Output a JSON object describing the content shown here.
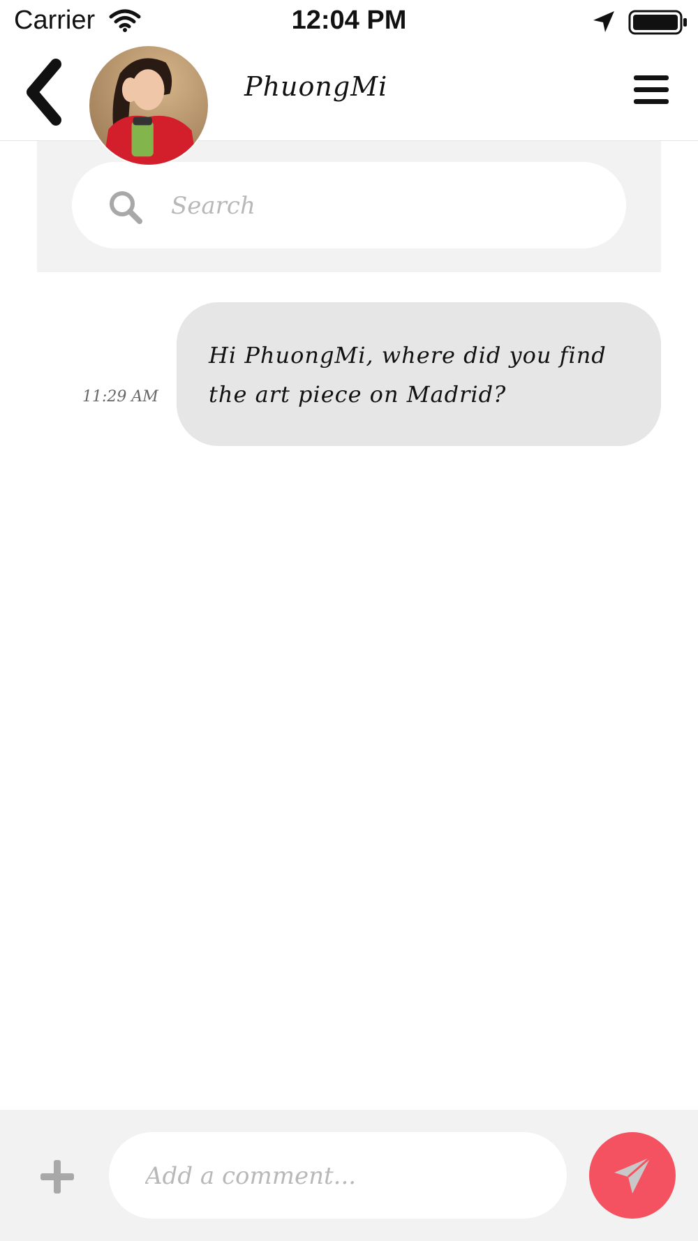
{
  "status_bar": {
    "carrier": "Carrier",
    "time": "12:04 PM",
    "icons": [
      "wifi-icon",
      "location-icon",
      "battery-icon"
    ]
  },
  "header": {
    "contact_name": "PhuongMi",
    "back_icon": "chevron-left-icon",
    "menu_icon": "hamburger-menu-icon",
    "avatar_icon": "profile-photo"
  },
  "search": {
    "placeholder": "Search",
    "value": "",
    "icon": "search-icon"
  },
  "messages": [
    {
      "time": "11:29 AM",
      "text": "Hi PhuongMi, where did you find the art piece on Madrid?"
    }
  ],
  "composer": {
    "placeholder": "Add a comment...",
    "value": "",
    "add_icon": "plus-icon",
    "send_icon": "paper-plane-icon"
  },
  "colors": {
    "accent": "#f45260",
    "panel": "#f2f2f2",
    "bubble": "#e6e6e6"
  }
}
